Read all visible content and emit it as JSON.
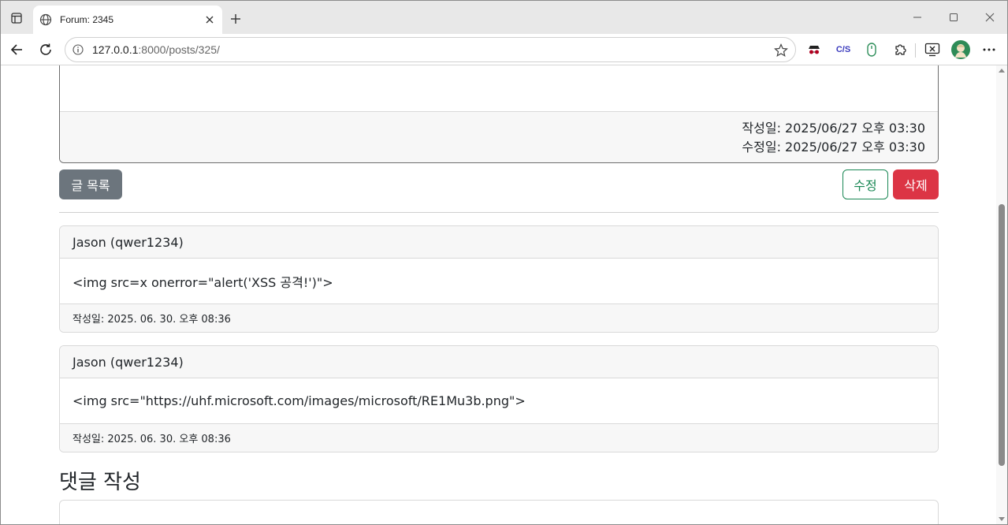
{
  "browser": {
    "tab_title": "Forum: 2345",
    "url_host": "127.0.0.1",
    "url_path": ":8000/posts/325/"
  },
  "post": {
    "created_label": "작성일: 2025/06/27 오후 03:30",
    "modified_label": "수정일: 2025/06/27 오후 03:30"
  },
  "actions": {
    "list_label": "글 목록",
    "edit_label": "수정",
    "delete_label": "삭제"
  },
  "comments": [
    {
      "author": "Jason (qwer1234)",
      "content": "<img src=x onerror=\"alert('XSS 공격!')\">",
      "date": "작성일: 2025. 06. 30. 오후 08:36"
    },
    {
      "author": "Jason (qwer1234)",
      "content": "<img src=\"https://uhf.microsoft.com/images/microsoft/RE1Mu3b.png\">",
      "date": "작성일: 2025. 06. 30. 오후 08:36"
    }
  ],
  "comment_form": {
    "title": "댓글 작성"
  },
  "extensions": {
    "cjs_label": "C/S"
  },
  "colors": {
    "secondary": "#6c757d",
    "success": "#198754",
    "danger": "#dc3545"
  }
}
